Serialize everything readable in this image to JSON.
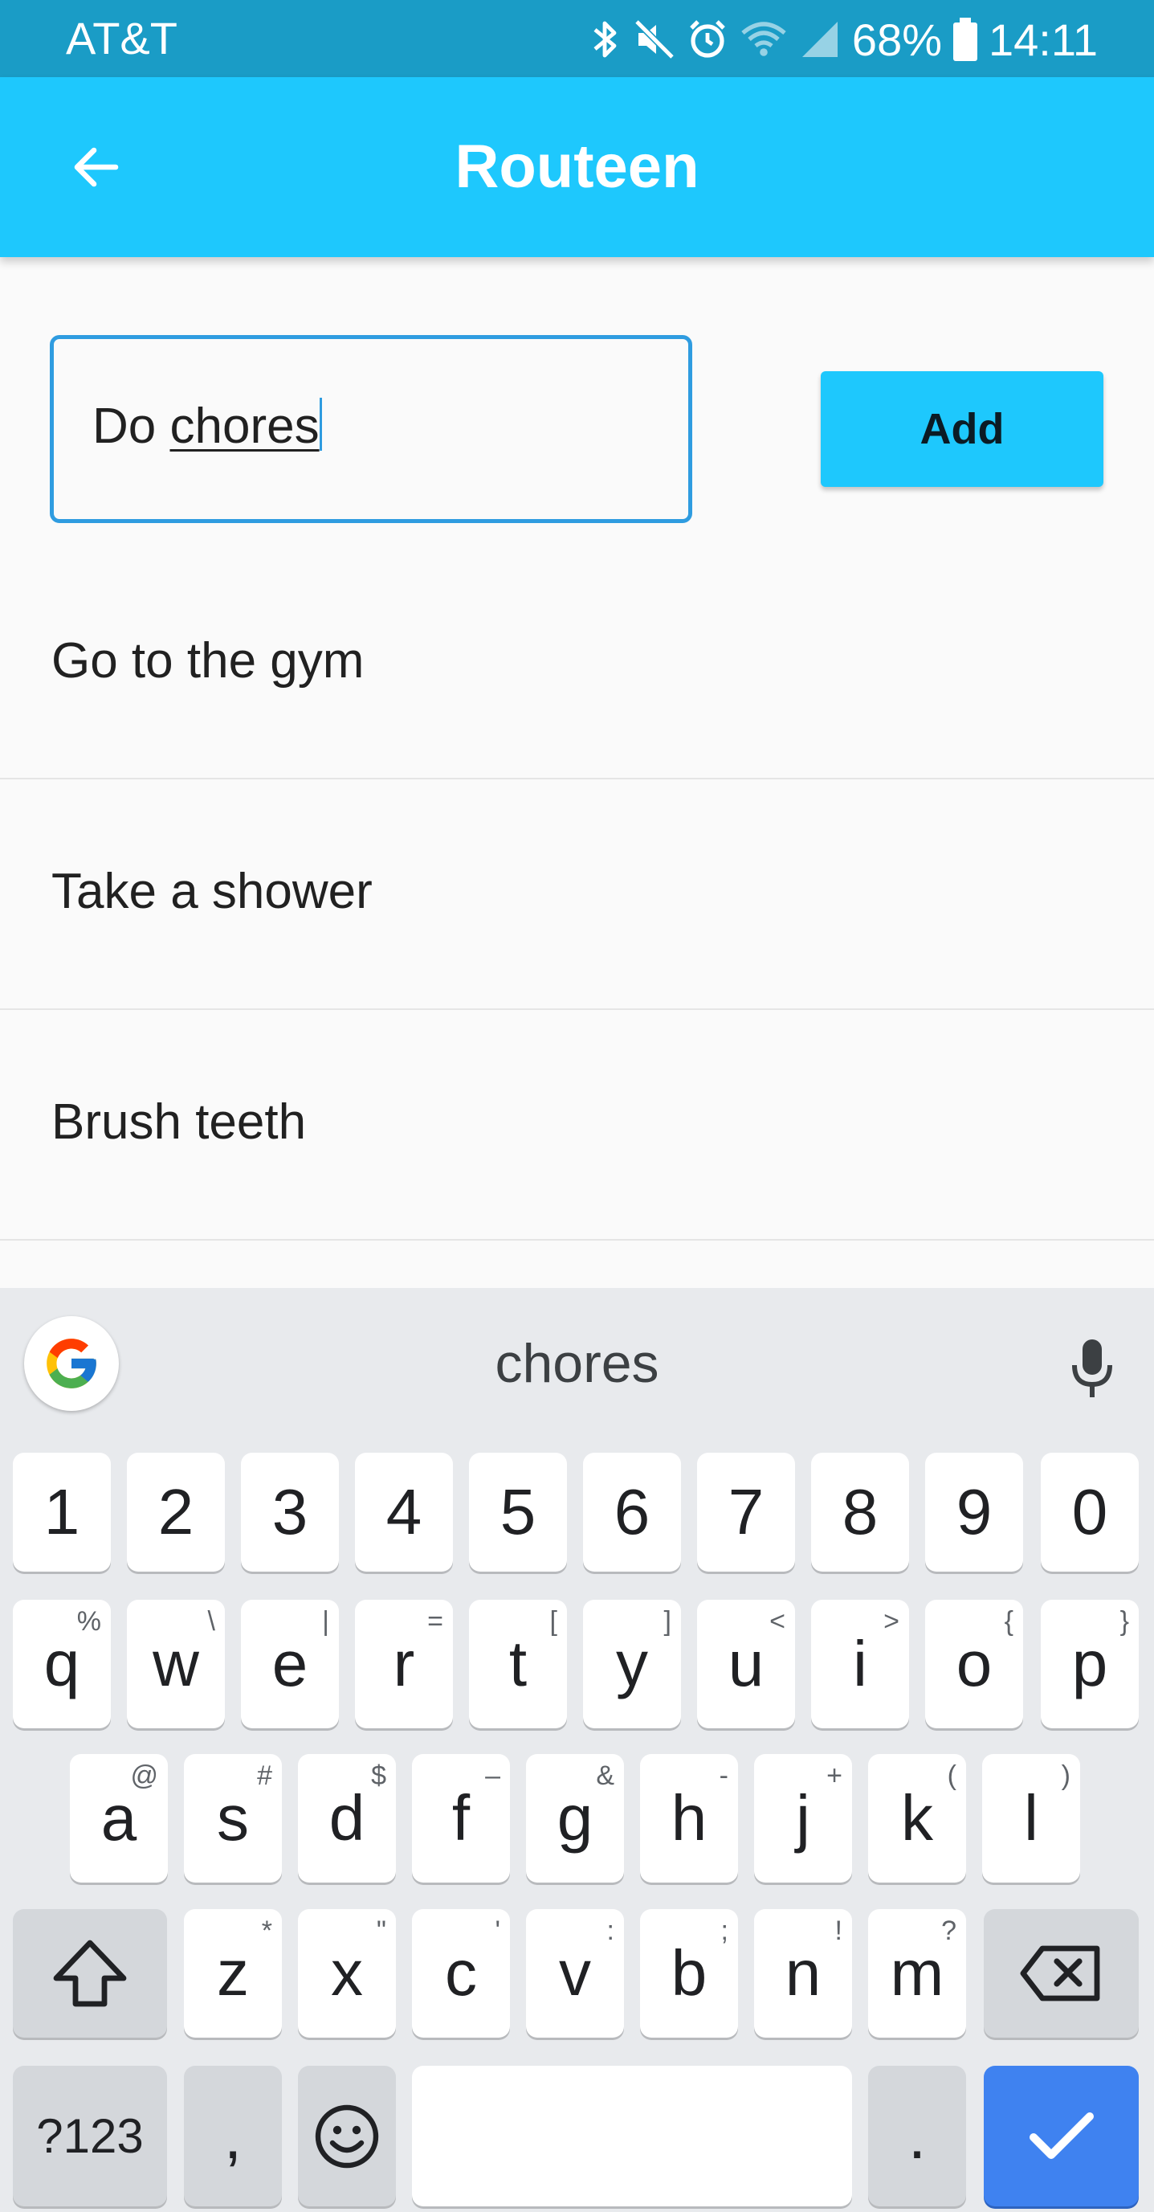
{
  "status_bar": {
    "carrier": "AT&T",
    "battery": "68%",
    "time": "14:11",
    "icons": [
      "bluetooth-icon",
      "mute-icon",
      "alarm-icon",
      "wifi-icon",
      "signal-icon",
      "battery-icon"
    ]
  },
  "app_bar": {
    "title": "Routeen",
    "back_icon": "arrow-back-icon"
  },
  "form": {
    "input_value_prefix": "Do ",
    "input_value_composing": "chores",
    "add_label": "Add"
  },
  "tasks": [
    {
      "label": "Go to the gym"
    },
    {
      "label": "Take a shower"
    },
    {
      "label": "Brush teeth"
    }
  ],
  "keyboard": {
    "suggestion": "chores",
    "number_row": [
      "1",
      "2",
      "3",
      "4",
      "5",
      "6",
      "7",
      "8",
      "9",
      "0"
    ],
    "row1": [
      {
        "key": "q",
        "hint": "%"
      },
      {
        "key": "w",
        "hint": "\\"
      },
      {
        "key": "e",
        "hint": "|"
      },
      {
        "key": "r",
        "hint": "="
      },
      {
        "key": "t",
        "hint": "["
      },
      {
        "key": "y",
        "hint": "]"
      },
      {
        "key": "u",
        "hint": "<"
      },
      {
        "key": "i",
        "hint": ">"
      },
      {
        "key": "o",
        "hint": "{"
      },
      {
        "key": "p",
        "hint": "}"
      }
    ],
    "row2": [
      {
        "key": "a",
        "hint": "@"
      },
      {
        "key": "s",
        "hint": "#"
      },
      {
        "key": "d",
        "hint": "$"
      },
      {
        "key": "f",
        "hint": "–"
      },
      {
        "key": "g",
        "hint": "&"
      },
      {
        "key": "h",
        "hint": "-"
      },
      {
        "key": "j",
        "hint": "+"
      },
      {
        "key": "k",
        "hint": "("
      },
      {
        "key": "l",
        "hint": ")"
      }
    ],
    "row3": [
      {
        "key": "z",
        "hint": "*"
      },
      {
        "key": "x",
        "hint": "\""
      },
      {
        "key": "c",
        "hint": "'"
      },
      {
        "key": "v",
        "hint": ":"
      },
      {
        "key": "b",
        "hint": ";"
      },
      {
        "key": "n",
        "hint": "!"
      },
      {
        "key": "m",
        "hint": "?"
      }
    ],
    "symbols_label": "?123",
    "comma_label": ",",
    "period_label": "."
  },
  "colors": {
    "status_bar": "#1a9cc6",
    "app_bar": "#1ec8fd",
    "input_border": "#2f9ce0",
    "enter_key": "#3f82f0"
  }
}
